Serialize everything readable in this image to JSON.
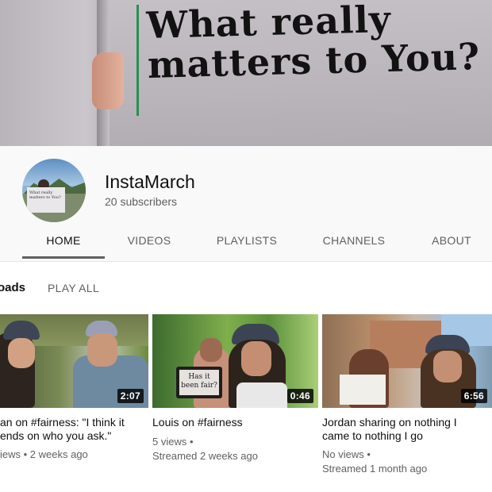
{
  "banner": {
    "line1": "What really",
    "line2": "matters to You?"
  },
  "channel": {
    "name": "InstaMarch",
    "subscribers": "20 subscribers",
    "avatar_sign": "What really matters to You?"
  },
  "tabs": [
    {
      "label": "HOME",
      "active": true
    },
    {
      "label": "VIDEOS",
      "active": false
    },
    {
      "label": "PLAYLISTS",
      "active": false
    },
    {
      "label": "CHANNELS",
      "active": false
    },
    {
      "label": "ABOUT",
      "active": false
    }
  ],
  "section": {
    "title": "oads",
    "play_all": "PLAY ALL"
  },
  "videos": [
    {
      "title_line1": "an on #fairness: \"I think it",
      "title_line2": "ends on who you ask.\"",
      "views": "iews",
      "age": "2 weeks ago",
      "duration": "2:07"
    },
    {
      "title_line1": "Louis on #fairness",
      "title_line2": "",
      "views": "5 views",
      "age": "Streamed 2 weeks ago",
      "duration": "0:46",
      "sign_text": "Has it been fair?"
    },
    {
      "title_line1": "Jordan sharing on nothing I",
      "title_line2": "came to nothing I go",
      "views": "No views",
      "age": "Streamed 1 month ago",
      "duration": "6:56"
    }
  ],
  "colors": {
    "accent_text": "#0f0f0f",
    "secondary_text": "#606060",
    "header_bg": "#f9f9f9",
    "tab_indicator": "#606060"
  }
}
